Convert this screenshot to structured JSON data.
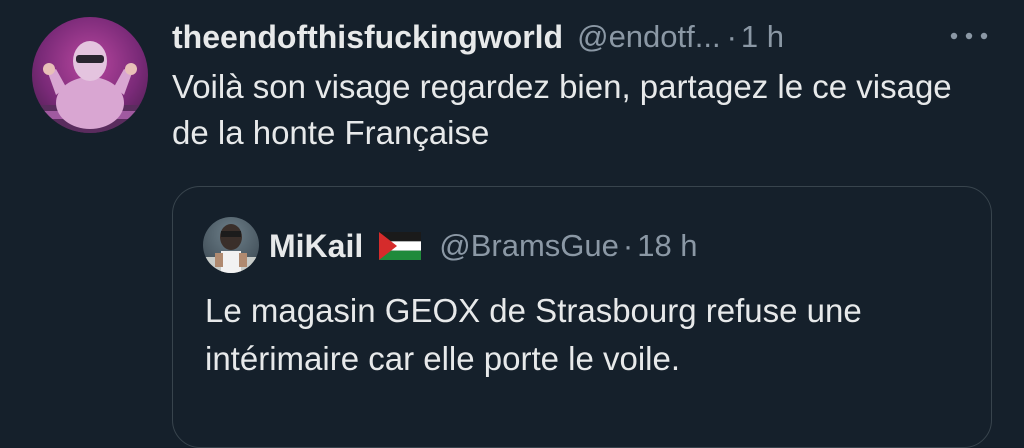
{
  "tweet": {
    "display_name": "theendofthisfuckingworld",
    "handle": "@endotf...",
    "separator": "·",
    "time": "1 h",
    "text": "Voilà son visage regardez bien, partagez le ce visage de la honte Française",
    "more_icon": "more-dots-icon"
  },
  "quoted_tweet": {
    "display_name": "MiKail",
    "flag_icon": "palestine-flag-icon",
    "handle": "@BramsGue",
    "separator": "·",
    "time": "18 h",
    "text": "Le magasin GEOX de Strasbourg refuse une intérimaire car elle porte le voile."
  },
  "colors": {
    "background": "#15202b",
    "primary_text": "#e7e9ea",
    "secondary_text": "#8b98a5",
    "border": "#38444d"
  }
}
